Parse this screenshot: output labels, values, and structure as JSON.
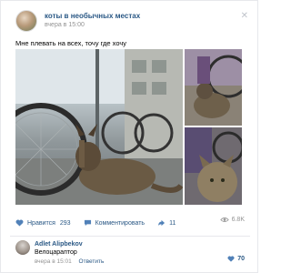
{
  "post": {
    "group_name": "коты в необычных местах",
    "time": "вчера в 15:00",
    "text": "Мне плевать на всех, точу где хочу"
  },
  "actions": {
    "like_label": "Нравится",
    "like_count": "293",
    "comment_label": "Комментировать",
    "share_count": "11",
    "views_count": "6.8K"
  },
  "comment": {
    "author": "Adlet Alipbekov",
    "text": "Велоцараптор",
    "time": "вчера в 15:01",
    "reply_label": "Ответить",
    "like_count": "70"
  },
  "colors": {
    "link": "#2a5885",
    "meta": "#939393",
    "border": "#e7e8ec"
  }
}
